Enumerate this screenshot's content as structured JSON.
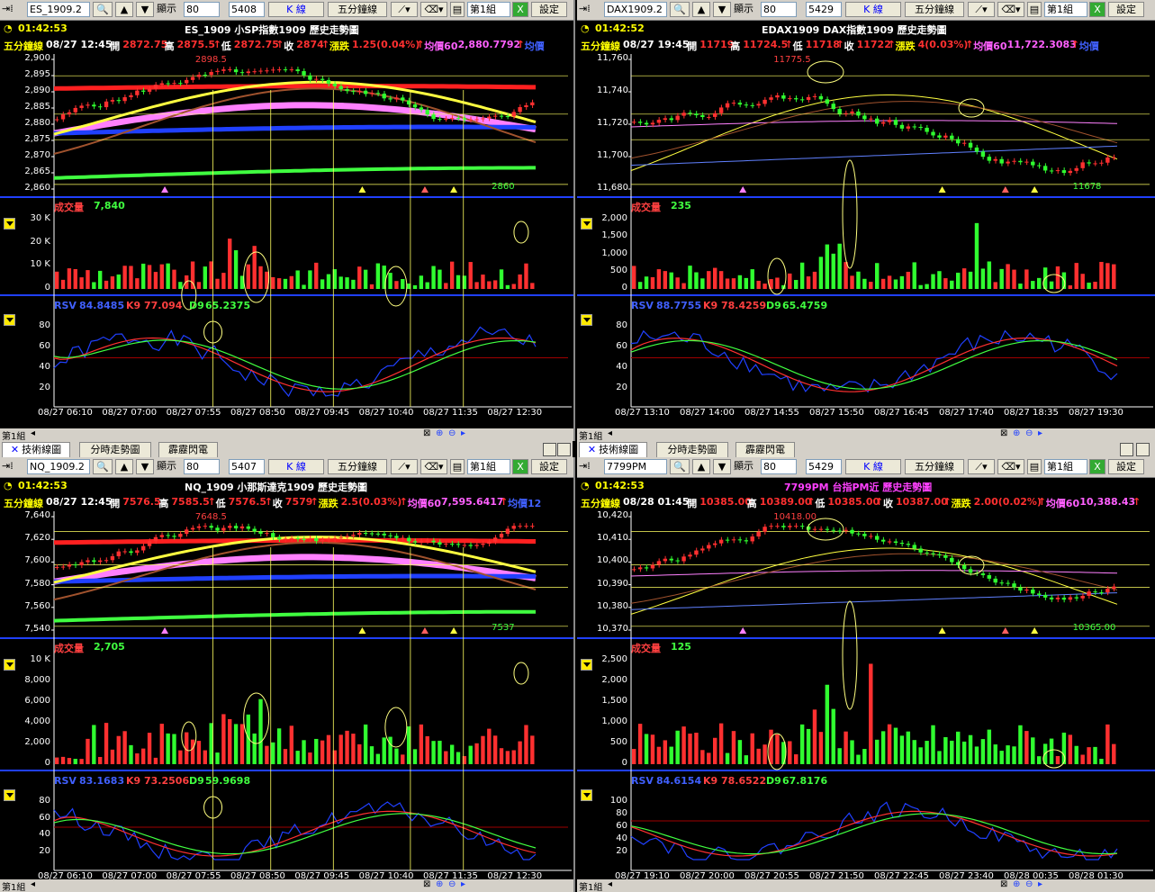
{
  "windows": [
    {
      "id": "es",
      "symbol": "ES_1909.2",
      "display_label": "顯示",
      "bars": "80",
      "total": "5408",
      "chart_type": "K 線",
      "interval": "五分鐘線",
      "group": "第1組",
      "settings": "設定",
      "time": "01:42:53",
      "title": "ES_1909 小SP指數1909  歷史走勢圖",
      "info": {
        "interval": "五分鐘線",
        "date": "08/27 12:45",
        "open_l": "開",
        "open": "2872.75",
        "high_l": "高",
        "high": "2875.5",
        "low_l": "低",
        "low": "2872.75",
        "close_l": "收",
        "close": "2874",
        "chg_l": "漲跌",
        "chg": "1.25(0.04%)",
        "ma_l": "均價60",
        "ma": "2,880.7792",
        "ma2_l": "均價"
      },
      "price_ticks": [
        "2,900",
        "2,895",
        "2,890",
        "2,885",
        "2,880",
        "2,875",
        "2,870",
        "2,865",
        "2,860"
      ],
      "high_mark": "2898.5",
      "low_mark": "2860",
      "volume": {
        "label": "成交量",
        "value": "7,840",
        "ticks": [
          "30 K",
          "20 K",
          "10 K",
          "0"
        ]
      },
      "kd": {
        "rsv_l": "RSV",
        "rsv": "84.8485",
        "k_l": "K9",
        "k": "77.094",
        "d_l": "D9",
        "d": "65.2375",
        "ticks": [
          "80",
          "60",
          "40",
          "20"
        ]
      },
      "x_ticks": [
        "08/27 06:10",
        "08/27 07:00",
        "08/27 07:55",
        "08/27 08:50",
        "08/27 09:45",
        "08/27 10:40",
        "08/27 11:35",
        "08/27 12:30"
      ],
      "bottom_group": "第1組"
    },
    {
      "id": "dax",
      "symbol": "DAX1909.2",
      "display_label": "顯示",
      "bars": "80",
      "total": "5429",
      "chart_type": "K 線",
      "interval": "五分鐘線",
      "group": "第1組",
      "settings": "設定",
      "time": "01:42:52",
      "title": "EDAX1909 DAX指數1909  歷史走勢圖",
      "info": {
        "interval": "五分鐘線",
        "date": "08/27 19:45",
        "open_l": "開",
        "open": "11719",
        "high_l": "高",
        "high": "11724.5",
        "low_l": "低",
        "low": "11718",
        "close_l": "收",
        "close": "11722",
        "chg_l": "漲跌",
        "chg": "4(0.03%)",
        "ma_l": "均價60",
        "ma": "11,722.3083",
        "ma2_l": "均價"
      },
      "price_ticks": [
        "11,760",
        "11,740",
        "11,720",
        "11,700",
        "11,680"
      ],
      "high_mark": "11775.5",
      "low_mark": "11678",
      "volume": {
        "label": "成交量",
        "value": "235",
        "ticks": [
          "2,000",
          "1,500",
          "1,000",
          "500",
          "0"
        ]
      },
      "kd": {
        "rsv_l": "RSV",
        "rsv": "88.7755",
        "k_l": "K9",
        "k": "78.4259",
        "d_l": "D9",
        "d": "65.4759",
        "ticks": [
          "80",
          "60",
          "40",
          "20"
        ]
      },
      "x_ticks": [
        "08/27 13:10",
        "08/27 14:00",
        "08/27 14:55",
        "08/27 15:50",
        "08/27 16:45",
        "08/27 17:40",
        "08/27 18:35",
        "08/27 19:30"
      ],
      "bottom_group": "第1組"
    },
    {
      "id": "nq",
      "symbol": "NQ_1909.2",
      "display_label": "顯示",
      "bars": "80",
      "total": "5407",
      "chart_type": "K 線",
      "interval": "五分鐘線",
      "group": "第1組",
      "settings": "設定",
      "time": "01:42:53",
      "title": "NQ_1909 小那斯達克1909  歷史走勢圖",
      "info": {
        "interval": "五分鐘線",
        "date": "08/27 12:45",
        "open_l": "開",
        "open": "7576.5",
        "high_l": "高",
        "high": "7585.5",
        "low_l": "低",
        "low": "7576.5",
        "close_l": "收",
        "close": "7579",
        "chg_l": "漲跌",
        "chg": "2.5(0.03%)",
        "ma_l": "均價60",
        "ma": "7,595.6417",
        "ma2_l": "均價12"
      },
      "price_ticks": [
        "7,640",
        "7,620",
        "7,600",
        "7,580",
        "7,560",
        "7,540"
      ],
      "high_mark": "7648.5",
      "low_mark": "7537",
      "volume": {
        "label": "成交量",
        "value": "2,705",
        "ticks": [
          "10 K",
          "8,000",
          "6,000",
          "4,000",
          "2,000",
          "0"
        ]
      },
      "kd": {
        "rsv_l": "RSV",
        "rsv": "83.1683",
        "k_l": "K9",
        "k": "73.2506",
        "d_l": "D9",
        "d": "59.9698",
        "ticks": [
          "80",
          "60",
          "40",
          "20"
        ]
      },
      "x_ticks": [
        "08/27 06:10",
        "08/27 07:00",
        "08/27 07:55",
        "08/27 08:50",
        "08/27 09:45",
        "08/27 10:40",
        "08/27 11:35",
        "08/27 12:30"
      ],
      "bottom_group": "第1組"
    },
    {
      "id": "tw",
      "symbol": "7799PM",
      "display_label": "顯示",
      "bars": "80",
      "total": "5429",
      "chart_type": "K 線",
      "interval": "五分鐘線",
      "group": "第1組",
      "settings": "設定",
      "time": "01:42:53",
      "title": "7799PM 台指PM近  歷史走勢圖",
      "info": {
        "interval": "五分鐘線",
        "date": "08/28 01:45",
        "open_l": "開",
        "open": "10385.00",
        "high_l": "高",
        "high": "10389.00",
        "low_l": "低",
        "low": "10385.00",
        "close_l": "收",
        "close": "10387.00",
        "chg_l": "漲跌",
        "chg": "2.00(0.02%)",
        "ma_l": "均價60",
        "ma": "10,388.43",
        "ma2_l": ""
      },
      "price_ticks": [
        "10,420",
        "10,410",
        "10,400",
        "10,390",
        "10,380",
        "10,370"
      ],
      "high_mark": "10418.00",
      "low_mark": "10365.00",
      "volume": {
        "label": "成交量",
        "value": "125",
        "ticks": [
          "2,500",
          "2,000",
          "1,500",
          "1,000",
          "500",
          "0"
        ]
      },
      "kd": {
        "rsv_l": "RSV",
        "rsv": "84.6154",
        "k_l": "K9",
        "k": "78.6522",
        "d_l": "D9",
        "d": "67.8176",
        "ticks": [
          "100",
          "80",
          "60",
          "40",
          "20"
        ]
      },
      "x_ticks": [
        "08/27 19:10",
        "08/27 20:00",
        "08/27 20:55",
        "08/27 21:50",
        "08/27 22:45",
        "08/27 23:40",
        "08/28 00:35",
        "08/28 01:30"
      ],
      "bottom_group": "第1組"
    }
  ],
  "tabs": {
    "tech": "技術線圖",
    "intraday": "分時走勢圖",
    "news": "霹靂閃電"
  },
  "colors": {
    "up": "#ff2020",
    "down": "#20ff20",
    "axis": "#2040ff",
    "yellow": "#ffff00"
  }
}
